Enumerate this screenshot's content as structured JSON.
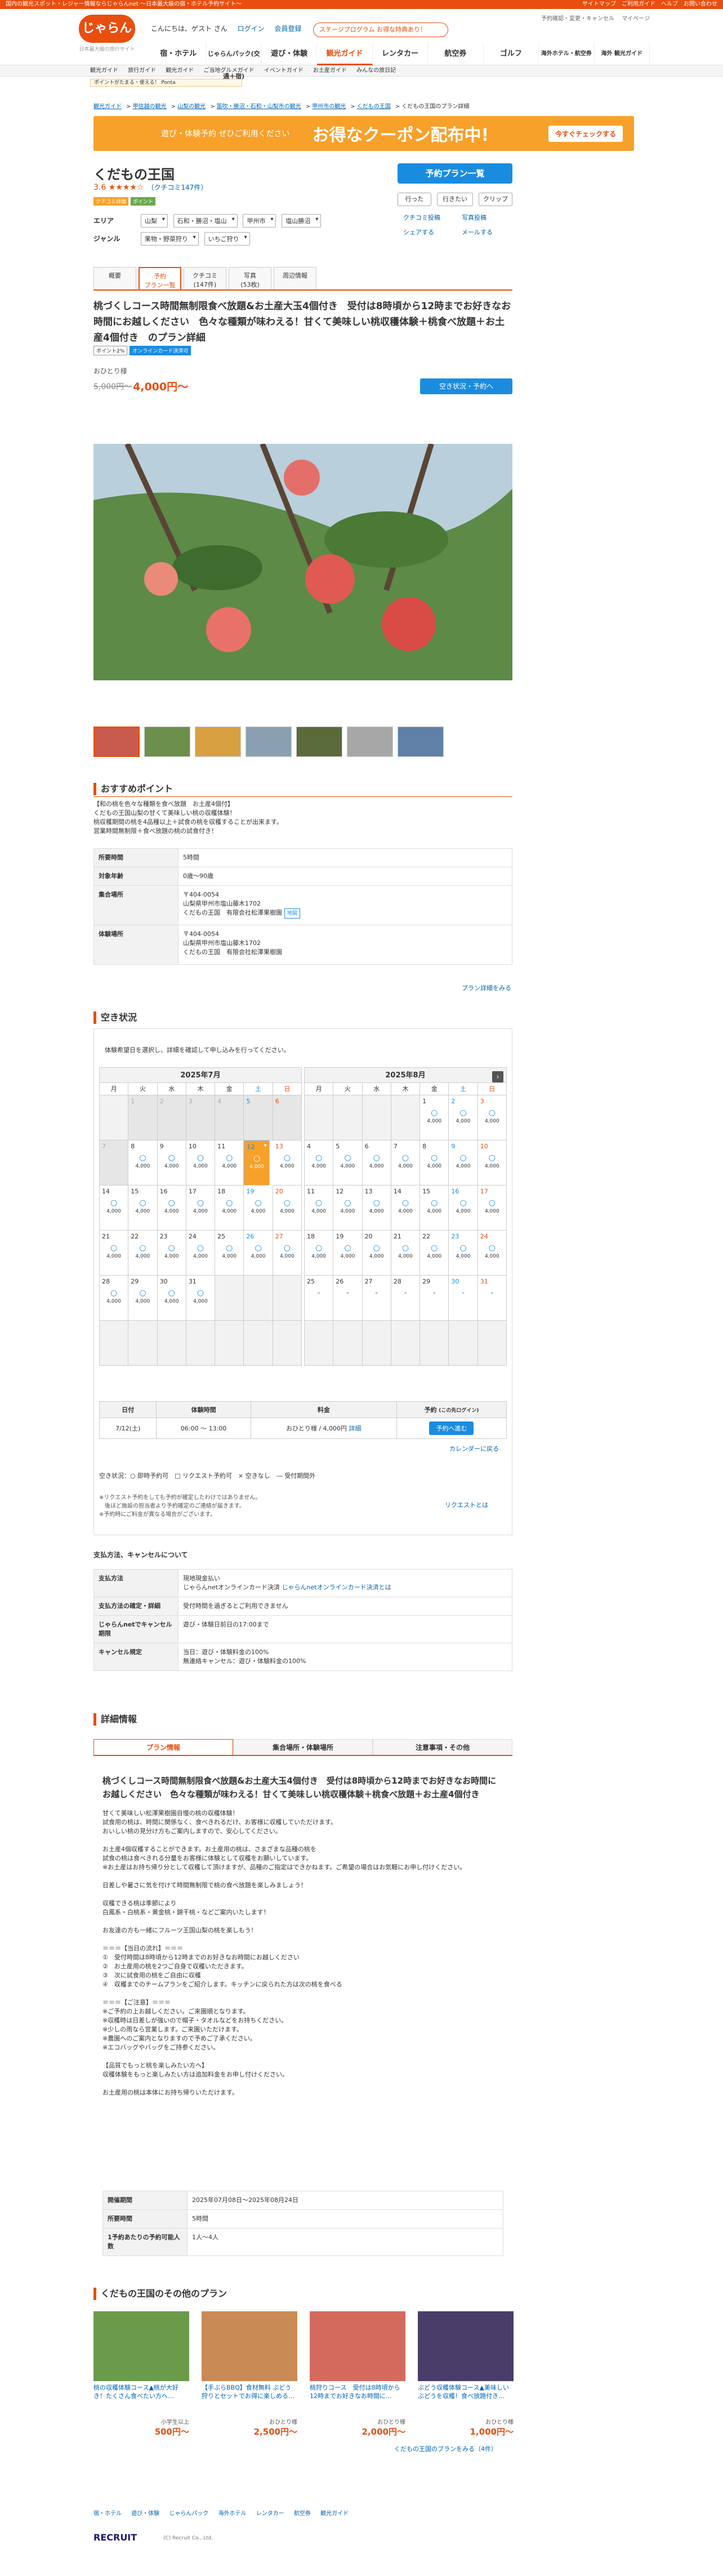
{
  "topstrip": {
    "left": "国内の観光スポット・レジャー情報ならじゃらんnet ～日本最大級の宿・ホテル予約サイト～",
    "right": "サイトマップ　ご利用ガイド　ヘルプ　お問い合わせ"
  },
  "header": {
    "logo": "じゃらん",
    "logo_sub": "日本最大級の旅行サイト",
    "greeting": "こんにちは、ゲスト さん",
    "login": "ログイン",
    "register": "会員登録",
    "links": [
      "予約確認・変更・キャンセル",
      "マイページ"
    ],
    "stage": "ステージプログラム",
    "stage_desc": "お得な特典あり！"
  },
  "nav": [
    "宿・ホテル",
    "じゃらんパック(交通＋宿)",
    "遊び・体験",
    "観光ガイド",
    "レンタカー",
    "航空券",
    "ゴルフ",
    "海外ホテル・航空券",
    "海外 観光ガイド"
  ],
  "subnav": [
    "観光ガイド",
    "旅行ガイド",
    "観光ガイド",
    "ご当地グルメガイド",
    "イベントガイド",
    "お土産ガイド",
    "みんなの旅日記"
  ],
  "promo_strip": "ポイントがたまる・使える！ Ponta",
  "breadcrumb": [
    "観光ガイド",
    "甲信越の観光",
    "山梨の観光",
    "笛吹・勝沼・石和・山梨市の観光",
    "甲州市の観光",
    "くだもの王国",
    "くだもの王国のプラン詳細"
  ],
  "coupon": {
    "left": "遊び・体験予約 ぜひご利用ください",
    "main": "お得なクーポン配布中!",
    "btn": "今すぐチェックする"
  },
  "title": "くだもの王国",
  "rating": {
    "score": "3.6",
    "stars": "★★★★☆",
    "count": "（クチコミ147件）"
  },
  "badges": [
    "クチコミ評価",
    "ポイント"
  ],
  "area": {
    "label": "エリア",
    "values": [
      "山梨",
      "石和・勝沼・塩山",
      "甲州市",
      "塩山勝沼"
    ]
  },
  "genre": {
    "label": "ジャンル",
    "values": [
      "果物・野菜狩り",
      "いちご狩り"
    ]
  },
  "right": {
    "reserve": "予約プラン一覧",
    "go": "行った",
    "want": "行きたい",
    "clip": "クリップ",
    "post": "クチコミ投稿",
    "photo_post": "写真投稿",
    "share": "シェアする",
    "mail": "メールする"
  },
  "tabs": [
    {
      "l1": "概要",
      "l2": ""
    },
    {
      "l1": "予約",
      "l2": "プラン一覧"
    },
    {
      "l1": "クチコミ",
      "l2": "(147件)"
    },
    {
      "l1": "写真",
      "l2": "(53枚)"
    },
    {
      "l1": "周辺情報",
      "l2": ""
    }
  ],
  "plan": {
    "title": "桃づくしコース時間無制限食べ放題&お土産大玉4個付き　受付は8時頃から12時までお好きなお時間にお越しください　色々な種類が味わえる！甘くて美味しい桃収穫体験＋桃食べ放題＋お土産4個付き　のプラン詳細",
    "tags": [
      "ポイント2%",
      "オンラインカード決済可"
    ],
    "person": "おひとり様",
    "old_price": "5,000円～",
    "new_price": "4,000円～",
    "vac_btn": "空き状況・予約へ"
  },
  "point": {
    "heading": "おすすめポイント",
    "body": "【和の桃を色々な種類を食べ放題　お土産4個付】\nくだもの王国山梨の甘くて美味しい桃の収穫体験！\n桃収穫期間の桃を4品種以上＋試食の桃を収穫することが出来ます。\n営業時間無制限＋食べ放題の桃の試食付き！"
  },
  "info": [
    {
      "k": "所要時間",
      "v": "5時間"
    },
    {
      "k": "対象年齢",
      "v": "0歳～90歳"
    },
    {
      "k": "集合場所",
      "v": "〒404-0054\n山梨県甲州市塩山藤木1702\nくだもの王国　有限会社松澤果樹園",
      "map": "地図"
    },
    {
      "k": "体験場所",
      "v": "〒404-0054\n山梨県甲州市塩山藤木1702\nくだもの王国　有限会社松澤果樹園"
    }
  ],
  "more_plan": "プラン詳細をみる",
  "vac": {
    "heading": "空き状況",
    "intro": "体験希望日を選択し、詳細を確認して申し込みを行ってください。",
    "cal_link": "カレンダーに戻る",
    "dow": [
      "月",
      "火",
      "水",
      "木",
      "金",
      "土",
      "日"
    ],
    "jul": {
      "title": "2025年7月",
      "cells": [
        {
          "d": "",
          "t": "blank"
        },
        {
          "d": "1",
          "t": "past"
        },
        {
          "d": "2",
          "t": "past"
        },
        {
          "d": "3",
          "t": "past"
        },
        {
          "d": "4",
          "t": "past"
        },
        {
          "d": "5",
          "t": "past"
        },
        {
          "d": "6",
          "t": "past"
        },
        {
          "d": "7",
          "t": "past"
        },
        {
          "d": "8",
          "m": "○",
          "p": "4,000"
        },
        {
          "d": "9",
          "m": "○",
          "p": "4,000"
        },
        {
          "d": "10",
          "m": "○",
          "p": "4,000"
        },
        {
          "d": "11",
          "m": "○",
          "p": "4,000"
        },
        {
          "d": "12",
          "m": "○",
          "p": "4,000",
          "t": "sel"
        },
        {
          "d": "13",
          "m": "○",
          "p": "4,000"
        },
        {
          "d": "14",
          "m": "○",
          "p": "4,000"
        },
        {
          "d": "15",
          "m": "○",
          "p": "4,000"
        },
        {
          "d": "16",
          "m": "○",
          "p": "4,000"
        },
        {
          "d": "17",
          "m": "○",
          "p": "4,000"
        },
        {
          "d": "18",
          "m": "○",
          "p": "4,000"
        },
        {
          "d": "19",
          "m": "○",
          "p": "4,000"
        },
        {
          "d": "20",
          "m": "○",
          "p": "4,000"
        },
        {
          "d": "21",
          "m": "○",
          "p": "4,000"
        },
        {
          "d": "22",
          "m": "○",
          "p": "4,000"
        },
        {
          "d": "23",
          "m": "○",
          "p": "4,000"
        },
        {
          "d": "24",
          "m": "○",
          "p": "4,000"
        },
        {
          "d": "25",
          "m": "○",
          "p": "4,000"
        },
        {
          "d": "26",
          "m": "○",
          "p": "4,000"
        },
        {
          "d": "27",
          "m": "○",
          "p": "4,000"
        },
        {
          "d": "28",
          "m": "○",
          "p": "4,000"
        },
        {
          "d": "29",
          "m": "○",
          "p": "4,000"
        },
        {
          "d": "30",
          "m": "○",
          "p": "4,000"
        },
        {
          "d": "31",
          "m": "○",
          "p": "4,000"
        },
        {
          "d": "",
          "t": "blank"
        },
        {
          "d": "",
          "t": "blank"
        },
        {
          "d": "",
          "t": "blank"
        },
        {
          "d": "",
          "t": "blank"
        },
        {
          "d": "",
          "t": "blank"
        },
        {
          "d": "",
          "t": "blank"
        },
        {
          "d": "",
          "t": "blank"
        },
        {
          "d": "",
          "t": "blank"
        },
        {
          "d": "",
          "t": "blank"
        },
        {
          "d": "",
          "t": "blank"
        }
      ]
    },
    "aug": {
      "title": "2025年8月",
      "cells": [
        {
          "d": "",
          "t": "blank"
        },
        {
          "d": "",
          "t": "blank"
        },
        {
          "d": "",
          "t": "blank"
        },
        {
          "d": "",
          "t": "blank"
        },
        {
          "d": "1",
          "m": "○",
          "p": "4,000"
        },
        {
          "d": "2",
          "m": "○",
          "p": "4,000"
        },
        {
          "d": "3",
          "m": "○",
          "p": "4,000"
        },
        {
          "d": "4",
          "m": "○",
          "p": "4,000"
        },
        {
          "d": "5",
          "m": "○",
          "p": "4,000"
        },
        {
          "d": "6",
          "m": "○",
          "p": "4,000"
        },
        {
          "d": "7",
          "m": "○",
          "p": "4,000"
        },
        {
          "d": "8",
          "m": "○",
          "p": "4,000"
        },
        {
          "d": "9",
          "m": "○",
          "p": "4,000"
        },
        {
          "d": "10",
          "m": "○",
          "p": "4,000"
        },
        {
          "d": "11",
          "m": "○",
          "p": "4,000"
        },
        {
          "d": "12",
          "m": "○",
          "p": "4,000"
        },
        {
          "d": "13",
          "m": "○",
          "p": "4,000"
        },
        {
          "d": "14",
          "m": "○",
          "p": "4,000"
        },
        {
          "d": "15",
          "m": "○",
          "p": "4,000"
        },
        {
          "d": "16",
          "m": "○",
          "p": "4,000"
        },
        {
          "d": "17",
          "m": "○",
          "p": "4,000"
        },
        {
          "d": "18",
          "m": "○",
          "p": "4,000"
        },
        {
          "d": "19",
          "m": "○",
          "p": "4,000"
        },
        {
          "d": "20",
          "m": "○",
          "p": "4,000"
        },
        {
          "d": "21",
          "m": "○",
          "p": "4,000"
        },
        {
          "d": "22",
          "m": "○",
          "p": "4,000"
        },
        {
          "d": "23",
          "m": "○",
          "p": "4,000"
        },
        {
          "d": "24",
          "m": "○",
          "p": "4,000"
        },
        {
          "d": "25",
          "m": "-"
        },
        {
          "d": "26",
          "m": "-"
        },
        {
          "d": "27",
          "m": "-"
        },
        {
          "d": "28",
          "m": "-"
        },
        {
          "d": "29",
          "m": "-"
        },
        {
          "d": "30",
          "m": "-"
        },
        {
          "d": "31",
          "m": "-"
        },
        {
          "d": "",
          "t": "blank"
        },
        {
          "d": "",
          "t": "blank"
        },
        {
          "d": "",
          "t": "blank"
        },
        {
          "d": "",
          "t": "blank"
        },
        {
          "d": "",
          "t": "blank"
        },
        {
          "d": "",
          "t": "blank"
        },
        {
          "d": "",
          "t": "blank"
        }
      ]
    },
    "rtable": {
      "headers": [
        "日付",
        "体験時間",
        "料金",
        "予約"
      ],
      "row": [
        "7/12(土)",
        "06:00 ～ 13:00",
        "おひとり様 / 4,000円",
        "詳細"
      ],
      "btn": "予約へ進む",
      "note": "(この先ログイン)"
    },
    "legend": "空き状況：○ 即時予約可　□ リクエスト予約可　× 空きなし　― 受付期間外",
    "notes": "※リクエスト予約をしても予約が確定したわけではありません。\n　後ほど施設の担当者より予約確定のご連絡が届きます。\n※予約時にご料金が異なる場合がございます。",
    "request": "リクエストとは"
  },
  "pay": {
    "heading": "支払方法、キャンセルについて",
    "rows": [
      {
        "k": "支払方法",
        "v": "現地現金払い\nじゃらんnetオンラインカード決済",
        "link": "じゃらんnetオンラインカード決済とは"
      },
      {
        "k": "支払方法の確定・詳細",
        "v": "受付時間を過ぎるとご利用できません"
      },
      {
        "k": "じゃらんnetでキャンセル期限",
        "v": "遊び・体験日前日の17:00まで"
      },
      {
        "k": "キャンセル規定",
        "v": "当日：遊び・体験料金の100%\n無連絡キャンセル：遊び・体験料金の100%"
      }
    ]
  },
  "detail": {
    "heading": "詳細情報",
    "tabs": [
      "プラン情報",
      "集合場所・体験場所",
      "注意事項・その他"
    ],
    "title": "桃づくしコース時間無制限食べ放題&お土産大玉4個付き　受付は8時頃から12時までお好きなお時間にお越しください　色々な種類が味わえる！甘くて美味しい桃収穫体験＋桃食べ放題＋お土産4個付き",
    "body": "甘くて美味しい松澤果樹園自慢の桃の収穫体験！\n試食用の桃は、時間に関係なく、食べきれるだけ、お客様に収穫していただけます。\nおいしい桃の見分け方もご案内しますので、安心してください。\n\nお土産4個収穫することができます。お土産用の桃は、さまざまな品種の桃を\n試食の桃は食べきれる分量をお客様に体験として収穫をお願いしています。\n※お土産はお持ち帰り分として収穫して頂けますが、品種のご指定はできかねます。ご希望の場合はお気軽にお申し付けください。\n\n日差しや暑さに気を付けて時間無制限で桃の食べ放題を楽しみましょう！\n\n収穫できる桃は季節により\n白鳳系・白桃系・黄金桃・錦干桃・などご案内いたします！\n\nお友達の方も一緒にフルーツ王国山梨の桃を楽しもう！\n\n＝＝＝【当日の流れ】＝＝＝\n①　受付時間は8時頃から12時までのお好きなお時間にお越しください\n②　お土産用の桃を2つご自身で収穫いただきます。\n③　次に試食用の桃をご自由に収穫\n④　収穫までのチームプランをご紹介します。キッチンに戻られた方は次の桃を食べる\n\n＝＝＝【ご注意】＝＝＝\n※ご予約の上お越しください。ご来園順となります。\n※収穫時は日差しが強いので帽子・タオルなどをお持ちください。\n※少しの雨なら営業します。ご来園いただけます。\n※農園へのご案内となりますので予めご了承ください。\n※エコバッグやバッグをご持参ください。\n\n【品質でもっと桃を楽しみたい方へ】\n収穫体験をもっと楽しみたい方は追加料金をお申し付けください。\n\nお土産用の桃は本体にお持ち帰りいただけます。",
    "table": [
      {
        "k": "開催期間",
        "v": "2025年07月08日～2025年08月24日"
      },
      {
        "k": "所要時間",
        "v": "5時間"
      },
      {
        "k": "1予約あたりの予約可能人数",
        "v": "1人～4人"
      }
    ]
  },
  "others": {
    "heading": "くだもの王国のその他のプラン",
    "items": [
      {
        "title": "桃の収穫体験コース▲桃が大好き！たくさん食べたい方へ…",
        "sub": "小学生以上",
        "price": "500円～"
      },
      {
        "title": "【手ぶらBBQ】食材無料 ぶどう狩りとセットでお得に楽しめる…",
        "sub": "おひとり様",
        "price": "2,500円～"
      },
      {
        "title": "桃狩りコース　受付は8時頃から12時までお好きなお時間に…",
        "sub": "おひとり様",
        "price": "2,000円～"
      },
      {
        "title": "ぶどう収穫体験コース▲美味しいぶどうを収穫！食べ放題付き…",
        "sub": "おひとり様",
        "price": "1,000円～"
      }
    ],
    "more": "くだもの王国のプランをみる（4件）"
  },
  "footer": {
    "links": [
      "宿・ホテル",
      "遊び・体験",
      "じゃらんパック",
      "海外ホテル",
      "レンタカー",
      "航空券",
      "観光ガイド"
    ],
    "brand": "RECRUIT",
    "copy": "(C) Recruit Co., Ltd."
  },
  "colors": {
    "accent": "#e94e0f",
    "blue": "#1a8ce0",
    "coupon": "#f7a12a"
  }
}
